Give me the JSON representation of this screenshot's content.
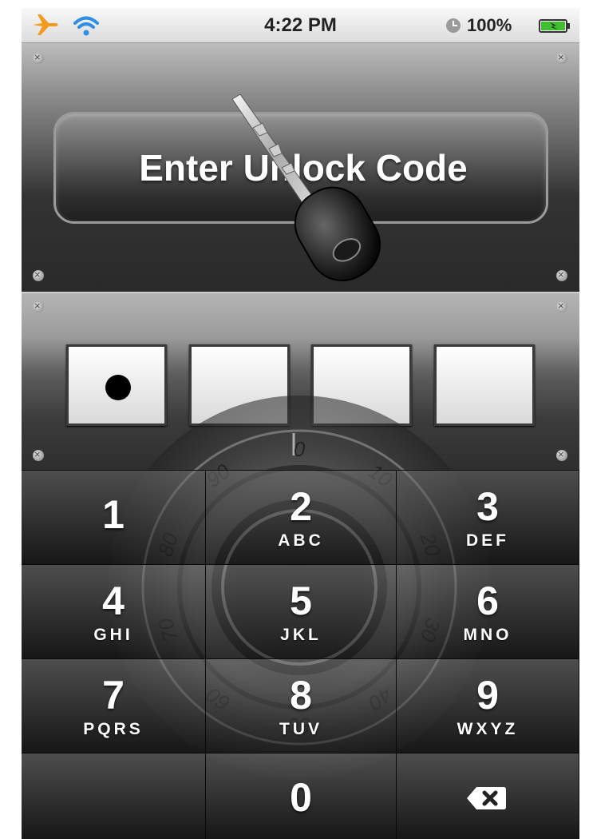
{
  "status_bar": {
    "time": "4:22 PM",
    "battery_percent": "100%",
    "icons": [
      "airplane-icon",
      "wifi-icon",
      "clock-icon",
      "battery-charging-icon"
    ]
  },
  "header": {
    "title": "Enter Unlock Code"
  },
  "code_entry": {
    "length": 4,
    "filled": 1
  },
  "dial": {
    "numbers": [
      "0",
      "10",
      "20",
      "30",
      "40",
      "50",
      "60",
      "70",
      "80",
      "90"
    ]
  },
  "keypad": {
    "keys": [
      {
        "number": "1",
        "letters": ""
      },
      {
        "number": "2",
        "letters": "ABC"
      },
      {
        "number": "3",
        "letters": "DEF"
      },
      {
        "number": "4",
        "letters": "GHI"
      },
      {
        "number": "5",
        "letters": "JKL"
      },
      {
        "number": "6",
        "letters": "MNO"
      },
      {
        "number": "7",
        "letters": "PQRS"
      },
      {
        "number": "8",
        "letters": "TUV"
      },
      {
        "number": "9",
        "letters": "WXYZ"
      },
      {
        "number": "",
        "letters": ""
      },
      {
        "number": "0",
        "letters": ""
      },
      {
        "number": "",
        "letters": "",
        "icon": "backspace-icon"
      }
    ]
  },
  "colors": {
    "airplane": "#f29a1d",
    "wifi": "#2f8fe6",
    "battery_fill": "#3fbf2f"
  }
}
